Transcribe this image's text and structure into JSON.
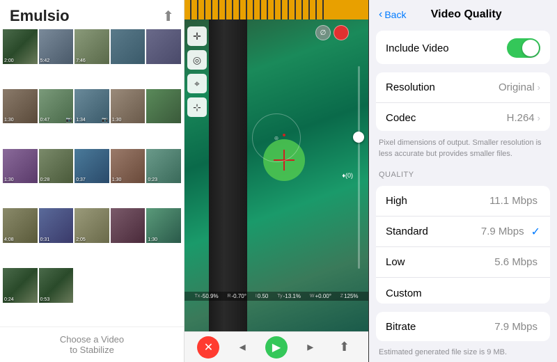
{
  "left": {
    "title": "Emulsio",
    "footer_line1": "Choose a Video",
    "footer_line2": "to Stabilize",
    "thumbnails": [
      {
        "time": "2:00",
        "has_cam": false
      },
      {
        "time": "5:42",
        "has_cam": false
      },
      {
        "time": "7:46",
        "has_cam": false
      },
      {
        "time": "",
        "has_cam": false
      },
      {
        "time": "",
        "has_cam": false
      },
      {
        "time": "1:30",
        "has_cam": false
      },
      {
        "time": "0:47",
        "has_cam": true
      },
      {
        "time": "1:34",
        "has_cam": true
      },
      {
        "time": "1:30",
        "has_cam": false
      },
      {
        "time": "",
        "has_cam": false
      },
      {
        "time": "1:30",
        "has_cam": false
      },
      {
        "time": "0:28",
        "has_cam": false
      },
      {
        "time": "0:37",
        "has_cam": false
      },
      {
        "time": "1:30",
        "has_cam": false
      },
      {
        "time": "0:23",
        "has_cam": false
      },
      {
        "time": "4:08",
        "has_cam": false
      },
      {
        "time": "0:31",
        "has_cam": false
      },
      {
        "time": "2:05",
        "has_cam": false
      },
      {
        "time": "",
        "has_cam": false
      },
      {
        "time": "1:30",
        "has_cam": false
      },
      {
        "time": "0:24",
        "has_cam": false
      },
      {
        "time": "0:53",
        "has_cam": false
      }
    ]
  },
  "middle": {
    "stats": [
      {
        "label": "Tx",
        "value": "-50.9%"
      },
      {
        "label": "R",
        "value": "-0.70°"
      },
      {
        "label": "I",
        "value": "0.50"
      },
      {
        "label": "Ty",
        "value": "-13.1%"
      },
      {
        "label": "W",
        "value": "+0.00°"
      },
      {
        "label": "Z",
        "value": "125%"
      }
    ],
    "tools": [
      "✛",
      "◎",
      "⌖",
      "⊹"
    ],
    "audio_label": "♦(0)"
  },
  "right": {
    "back_label": "Back",
    "page_title": "Video Quality",
    "include_video_label": "Include Video",
    "resolution_label": "Resolution",
    "resolution_value": "Original",
    "codec_label": "Codec",
    "codec_value": "H.264",
    "hint_text": "Pixel dimensions of output. Smaller resolution is less accurate but provides smaller files.",
    "quality_section_label": "QUALITY",
    "quality_options": [
      {
        "label": "High",
        "value": "11.1 Mbps",
        "selected": false
      },
      {
        "label": "Standard",
        "value": "7.9 Mbps",
        "selected": true
      },
      {
        "label": "Low",
        "value": "5.6 Mbps",
        "selected": false
      },
      {
        "label": "Custom",
        "value": "",
        "selected": false
      }
    ],
    "bitrate_label": "Bitrate",
    "bitrate_value": "7.9",
    "bitrate_unit": "Mbps",
    "bitrate_hint": "Estimated generated file size is 9 MB."
  },
  "icons": {
    "share": "⬆",
    "back_chevron": "‹",
    "chevron_right": "›",
    "play": "▶",
    "x_mark": "✕",
    "share_bottom": "⬆"
  }
}
